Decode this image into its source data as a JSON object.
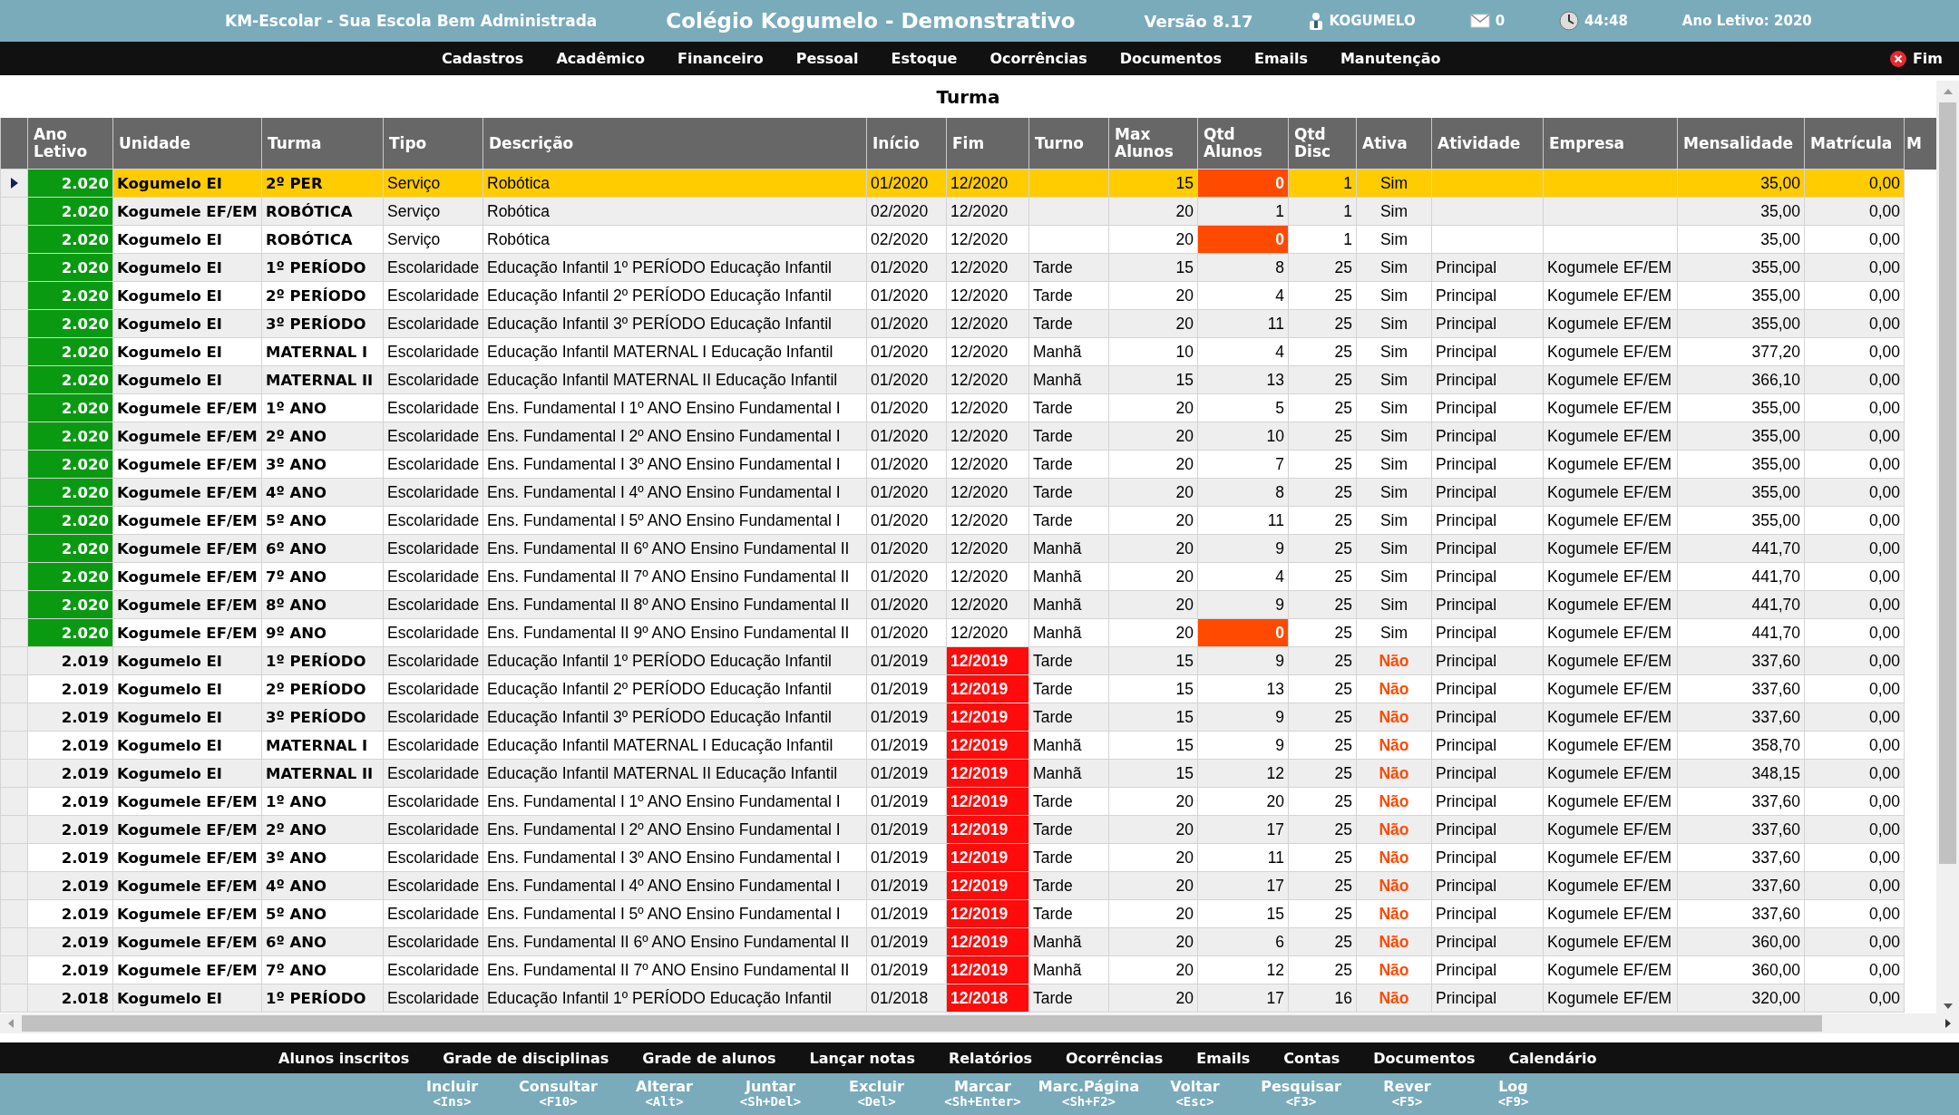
{
  "header": {
    "app_name": "KM-Escolar - Sua Escola Bem Administrada",
    "school": "Colégio Kogumelo - Demonstrativo",
    "version": "Versão 8.17",
    "user": "KOGUMELO",
    "messages": "0",
    "timer": "44:48",
    "school_year": "Ano Letivo: 2020"
  },
  "menu": [
    "Cadastros",
    "Acadêmico",
    "Financeiro",
    "Pessoal",
    "Estoque",
    "Ocorrências",
    "Documentos",
    "Emails",
    "Manutenção"
  ],
  "exit_label": "Fim",
  "title": "Turma",
  "table": {
    "columns": [
      "Ano Letivo",
      "Unidade",
      "Turma",
      "Tipo",
      "Descrição",
      "Início",
      "Fim",
      "Turno",
      "Max Alunos",
      "Qtd Alunos",
      "Qtd Disc",
      "Ativa",
      "Atividade",
      "Empresa",
      "Mensalidade",
      "Matrícula",
      "M"
    ],
    "rows": [
      {
        "selected": true,
        "current_year": true,
        "zero_students": true,
        "expired": false,
        "active": true,
        "cells": [
          "2.020",
          "Kogumelo EI",
          "2º PER",
          "Serviço",
          "Robótica",
          "01/2020",
          "12/2020",
          "",
          "15",
          "0",
          "1",
          "Sim",
          "",
          "",
          "35,00",
          "0,00"
        ]
      },
      {
        "selected": false,
        "current_year": true,
        "zero_students": false,
        "expired": false,
        "active": true,
        "cells": [
          "2.020",
          "Kogumele EF/EM",
          "ROBÓTICA",
          "Serviço",
          "Robótica",
          "02/2020",
          "12/2020",
          "",
          "20",
          "1",
          "1",
          "Sim",
          "",
          "",
          "35,00",
          "0,00"
        ]
      },
      {
        "selected": false,
        "current_year": true,
        "zero_students": true,
        "expired": false,
        "active": true,
        "cells": [
          "2.020",
          "Kogumelo EI",
          "ROBÓTICA",
          "Serviço",
          "Robótica",
          "02/2020",
          "12/2020",
          "",
          "20",
          "0",
          "1",
          "Sim",
          "",
          "",
          "35,00",
          "0,00"
        ]
      },
      {
        "selected": false,
        "current_year": true,
        "zero_students": false,
        "expired": false,
        "active": true,
        "cells": [
          "2.020",
          "Kogumelo EI",
          "1º PERÍODO",
          "Escolaridade",
          "Educação Infantil 1º PERÍODO Educação Infantil",
          "01/2020",
          "12/2020",
          "Tarde",
          "15",
          "8",
          "25",
          "Sim",
          "Principal",
          "Kogumele EF/EM",
          "355,00",
          "0,00"
        ]
      },
      {
        "selected": false,
        "current_year": true,
        "zero_students": false,
        "expired": false,
        "active": true,
        "cells": [
          "2.020",
          "Kogumelo EI",
          "2º PERÍODO",
          "Escolaridade",
          "Educação Infantil 2º PERÍODO Educação Infantil",
          "01/2020",
          "12/2020",
          "Tarde",
          "20",
          "4",
          "25",
          "Sim",
          "Principal",
          "Kogumele EF/EM",
          "355,00",
          "0,00"
        ]
      },
      {
        "selected": false,
        "current_year": true,
        "zero_students": false,
        "expired": false,
        "active": true,
        "cells": [
          "2.020",
          "Kogumelo EI",
          "3º PERÍODO",
          "Escolaridade",
          "Educação Infantil 3º PERÍODO Educação Infantil",
          "01/2020",
          "12/2020",
          "Tarde",
          "20",
          "11",
          "25",
          "Sim",
          "Principal",
          "Kogumele EF/EM",
          "355,00",
          "0,00"
        ]
      },
      {
        "selected": false,
        "current_year": true,
        "zero_students": false,
        "expired": false,
        "active": true,
        "cells": [
          "2.020",
          "Kogumelo EI",
          "MATERNAL I",
          "Escolaridade",
          "Educação Infantil MATERNAL I Educação Infantil",
          "01/2020",
          "12/2020",
          "Manhã",
          "10",
          "4",
          "25",
          "Sim",
          "Principal",
          "Kogumele EF/EM",
          "377,20",
          "0,00"
        ]
      },
      {
        "selected": false,
        "current_year": true,
        "zero_students": false,
        "expired": false,
        "active": true,
        "cells": [
          "2.020",
          "Kogumelo EI",
          "MATERNAL II",
          "Escolaridade",
          "Educação Infantil MATERNAL II Educação Infantil",
          "01/2020",
          "12/2020",
          "Manhã",
          "15",
          "13",
          "25",
          "Sim",
          "Principal",
          "Kogumele EF/EM",
          "366,10",
          "0,00"
        ]
      },
      {
        "selected": false,
        "current_year": true,
        "zero_students": false,
        "expired": false,
        "active": true,
        "cells": [
          "2.020",
          "Kogumele EF/EM",
          "1º ANO",
          "Escolaridade",
          "Ens. Fundamental I 1º ANO Ensino Fundamental I",
          "01/2020",
          "12/2020",
          "Tarde",
          "20",
          "5",
          "25",
          "Sim",
          "Principal",
          "Kogumele EF/EM",
          "355,00",
          "0,00"
        ]
      },
      {
        "selected": false,
        "current_year": true,
        "zero_students": false,
        "expired": false,
        "active": true,
        "cells": [
          "2.020",
          "Kogumele EF/EM",
          "2º ANO",
          "Escolaridade",
          "Ens. Fundamental I 2º ANO Ensino Fundamental I",
          "01/2020",
          "12/2020",
          "Tarde",
          "20",
          "10",
          "25",
          "Sim",
          "Principal",
          "Kogumele EF/EM",
          "355,00",
          "0,00"
        ]
      },
      {
        "selected": false,
        "current_year": true,
        "zero_students": false,
        "expired": false,
        "active": true,
        "cells": [
          "2.020",
          "Kogumele EF/EM",
          "3º ANO",
          "Escolaridade",
          "Ens. Fundamental I 3º ANO Ensino Fundamental I",
          "01/2020",
          "12/2020",
          "Tarde",
          "20",
          "7",
          "25",
          "Sim",
          "Principal",
          "Kogumele EF/EM",
          "355,00",
          "0,00"
        ]
      },
      {
        "selected": false,
        "current_year": true,
        "zero_students": false,
        "expired": false,
        "active": true,
        "cells": [
          "2.020",
          "Kogumele EF/EM",
          "4º ANO",
          "Escolaridade",
          "Ens. Fundamental I 4º ANO Ensino Fundamental I",
          "01/2020",
          "12/2020",
          "Tarde",
          "20",
          "8",
          "25",
          "Sim",
          "Principal",
          "Kogumele EF/EM",
          "355,00",
          "0,00"
        ]
      },
      {
        "selected": false,
        "current_year": true,
        "zero_students": false,
        "expired": false,
        "active": true,
        "cells": [
          "2.020",
          "Kogumele EF/EM",
          "5º ANO",
          "Escolaridade",
          "Ens. Fundamental I 5º ANO Ensino Fundamental I",
          "01/2020",
          "12/2020",
          "Tarde",
          "20",
          "11",
          "25",
          "Sim",
          "Principal",
          "Kogumele EF/EM",
          "355,00",
          "0,00"
        ]
      },
      {
        "selected": false,
        "current_year": true,
        "zero_students": false,
        "expired": false,
        "active": true,
        "cells": [
          "2.020",
          "Kogumele EF/EM",
          "6º ANO",
          "Escolaridade",
          "Ens. Fundamental II 6º ANO Ensino Fundamental II",
          "01/2020",
          "12/2020",
          "Manhã",
          "20",
          "9",
          "25",
          "Sim",
          "Principal",
          "Kogumele EF/EM",
          "441,70",
          "0,00"
        ]
      },
      {
        "selected": false,
        "current_year": true,
        "zero_students": false,
        "expired": false,
        "active": true,
        "cells": [
          "2.020",
          "Kogumele EF/EM",
          "7º ANO",
          "Escolaridade",
          "Ens. Fundamental II 7º ANO Ensino Fundamental II",
          "01/2020",
          "12/2020",
          "Manhã",
          "20",
          "4",
          "25",
          "Sim",
          "Principal",
          "Kogumele EF/EM",
          "441,70",
          "0,00"
        ]
      },
      {
        "selected": false,
        "current_year": true,
        "zero_students": false,
        "expired": false,
        "active": true,
        "cells": [
          "2.020",
          "Kogumele EF/EM",
          "8º ANO",
          "Escolaridade",
          "Ens. Fundamental II 8º ANO Ensino Fundamental II",
          "01/2020",
          "12/2020",
          "Manhã",
          "20",
          "9",
          "25",
          "Sim",
          "Principal",
          "Kogumele EF/EM",
          "441,70",
          "0,00"
        ]
      },
      {
        "selected": false,
        "current_year": true,
        "zero_students": true,
        "expired": false,
        "active": true,
        "cells": [
          "2.020",
          "Kogumele EF/EM",
          "9º ANO",
          "Escolaridade",
          "Ens. Fundamental II 9º ANO Ensino Fundamental II",
          "01/2020",
          "12/2020",
          "Manhã",
          "20",
          "0",
          "25",
          "Sim",
          "Principal",
          "Kogumele EF/EM",
          "441,70",
          "0,00"
        ]
      },
      {
        "selected": false,
        "current_year": false,
        "zero_students": false,
        "expired": true,
        "active": false,
        "cells": [
          "2.019",
          "Kogumelo EI",
          "1º PERÍODO",
          "Escolaridade",
          "Educação Infantil 1º PERÍODO Educação Infantil",
          "01/2019",
          "12/2019",
          "Tarde",
          "15",
          "9",
          "25",
          "Não",
          "Principal",
          "Kogumele EF/EM",
          "337,60",
          "0,00"
        ]
      },
      {
        "selected": false,
        "current_year": false,
        "zero_students": false,
        "expired": true,
        "active": false,
        "cells": [
          "2.019",
          "Kogumelo EI",
          "2º PERÍODO",
          "Escolaridade",
          "Educação Infantil 2º PERÍODO Educação Infantil",
          "01/2019",
          "12/2019",
          "Tarde",
          "15",
          "13",
          "25",
          "Não",
          "Principal",
          "Kogumele EF/EM",
          "337,60",
          "0,00"
        ]
      },
      {
        "selected": false,
        "current_year": false,
        "zero_students": false,
        "expired": true,
        "active": false,
        "cells": [
          "2.019",
          "Kogumelo EI",
          "3º PERÍODO",
          "Escolaridade",
          "Educação Infantil 3º PERÍODO Educação Infantil",
          "01/2019",
          "12/2019",
          "Tarde",
          "15",
          "9",
          "25",
          "Não",
          "Principal",
          "Kogumele EF/EM",
          "337,60",
          "0,00"
        ]
      },
      {
        "selected": false,
        "current_year": false,
        "zero_students": false,
        "expired": true,
        "active": false,
        "cells": [
          "2.019",
          "Kogumelo EI",
          "MATERNAL I",
          "Escolaridade",
          "Educação Infantil MATERNAL I Educação Infantil",
          "01/2019",
          "12/2019",
          "Manhã",
          "15",
          "9",
          "25",
          "Não",
          "Principal",
          "Kogumele EF/EM",
          "358,70",
          "0,00"
        ]
      },
      {
        "selected": false,
        "current_year": false,
        "zero_students": false,
        "expired": true,
        "active": false,
        "cells": [
          "2.019",
          "Kogumelo EI",
          "MATERNAL II",
          "Escolaridade",
          "Educação Infantil MATERNAL II Educação Infantil",
          "01/2019",
          "12/2019",
          "Manhã",
          "15",
          "12",
          "25",
          "Não",
          "Principal",
          "Kogumele EF/EM",
          "348,15",
          "0,00"
        ]
      },
      {
        "selected": false,
        "current_year": false,
        "zero_students": false,
        "expired": true,
        "active": false,
        "cells": [
          "2.019",
          "Kogumele EF/EM",
          "1º ANO",
          "Escolaridade",
          "Ens. Fundamental I 1º ANO Ensino Fundamental I",
          "01/2019",
          "12/2019",
          "Tarde",
          "20",
          "20",
          "25",
          "Não",
          "Principal",
          "Kogumele EF/EM",
          "337,60",
          "0,00"
        ]
      },
      {
        "selected": false,
        "current_year": false,
        "zero_students": false,
        "expired": true,
        "active": false,
        "cells": [
          "2.019",
          "Kogumele EF/EM",
          "2º ANO",
          "Escolaridade",
          "Ens. Fundamental I 2º ANO Ensino Fundamental I",
          "01/2019",
          "12/2019",
          "Tarde",
          "20",
          "17",
          "25",
          "Não",
          "Principal",
          "Kogumele EF/EM",
          "337,60",
          "0,00"
        ]
      },
      {
        "selected": false,
        "current_year": false,
        "zero_students": false,
        "expired": true,
        "active": false,
        "cells": [
          "2.019",
          "Kogumele EF/EM",
          "3º ANO",
          "Escolaridade",
          "Ens. Fundamental I 3º ANO Ensino Fundamental I",
          "01/2019",
          "12/2019",
          "Tarde",
          "20",
          "11",
          "25",
          "Não",
          "Principal",
          "Kogumele EF/EM",
          "337,60",
          "0,00"
        ]
      },
      {
        "selected": false,
        "current_year": false,
        "zero_students": false,
        "expired": true,
        "active": false,
        "cells": [
          "2.019",
          "Kogumele EF/EM",
          "4º ANO",
          "Escolaridade",
          "Ens. Fundamental I 4º ANO Ensino Fundamental I",
          "01/2019",
          "12/2019",
          "Tarde",
          "20",
          "17",
          "25",
          "Não",
          "Principal",
          "Kogumele EF/EM",
          "337,60",
          "0,00"
        ]
      },
      {
        "selected": false,
        "current_year": false,
        "zero_students": false,
        "expired": true,
        "active": false,
        "cells": [
          "2.019",
          "Kogumele EF/EM",
          "5º ANO",
          "Escolaridade",
          "Ens. Fundamental I 5º ANO Ensino Fundamental I",
          "01/2019",
          "12/2019",
          "Tarde",
          "20",
          "15",
          "25",
          "Não",
          "Principal",
          "Kogumele EF/EM",
          "337,60",
          "0,00"
        ]
      },
      {
        "selected": false,
        "current_year": false,
        "zero_students": false,
        "expired": true,
        "active": false,
        "cells": [
          "2.019",
          "Kogumele EF/EM",
          "6º ANO",
          "Escolaridade",
          "Ens. Fundamental II 6º ANO Ensino Fundamental II",
          "01/2019",
          "12/2019",
          "Manhã",
          "20",
          "6",
          "25",
          "Não",
          "Principal",
          "Kogumele EF/EM",
          "360,00",
          "0,00"
        ]
      },
      {
        "selected": false,
        "current_year": false,
        "zero_students": false,
        "expired": true,
        "active": false,
        "cells": [
          "2.019",
          "Kogumele EF/EM",
          "7º ANO",
          "Escolaridade",
          "Ens. Fundamental II 7º ANO Ensino Fundamental II",
          "01/2019",
          "12/2019",
          "Manhã",
          "20",
          "12",
          "25",
          "Não",
          "Principal",
          "Kogumele EF/EM",
          "360,00",
          "0,00"
        ]
      },
      {
        "selected": false,
        "current_year": false,
        "zero_students": false,
        "expired": true,
        "active": false,
        "cells": [
          "2.018",
          "Kogumelo EI",
          "1º PERÍODO",
          "Escolaridade",
          "Educação Infantil 1º PERÍODO Educação Infantil",
          "01/2018",
          "12/2018",
          "Tarde",
          "20",
          "17",
          "16",
          "Não",
          "Principal",
          "Kogumele EF/EM",
          "320,00",
          "0,00"
        ]
      }
    ]
  },
  "links": [
    "Alunos inscritos",
    "Grade de disciplinas",
    "Grade de alunos",
    "Lançar notas",
    "Relatórios",
    "Ocorrências",
    "Emails",
    "Contas",
    "Documentos",
    "Calendário"
  ],
  "actions": [
    {
      "label": "Incluir",
      "key": "<Ins>"
    },
    {
      "label": "Consultar",
      "key": "<F10>"
    },
    {
      "label": "Alterar",
      "key": "<Alt>"
    },
    {
      "label": "Juntar",
      "key": "<Sh+Del>"
    },
    {
      "label": "Excluir",
      "key": "<Del>"
    },
    {
      "label": "Marcar",
      "key": "<Sh+Enter>"
    },
    {
      "label": "Marc.Página",
      "key": "<Sh+F2>"
    },
    {
      "label": "Voltar",
      "key": "<Esc>"
    },
    {
      "label": "Pesquisar",
      "key": "<F3>"
    },
    {
      "label": "Rever",
      "key": "<F5>"
    },
    {
      "label": "Log",
      "key": "<F9>"
    }
  ]
}
